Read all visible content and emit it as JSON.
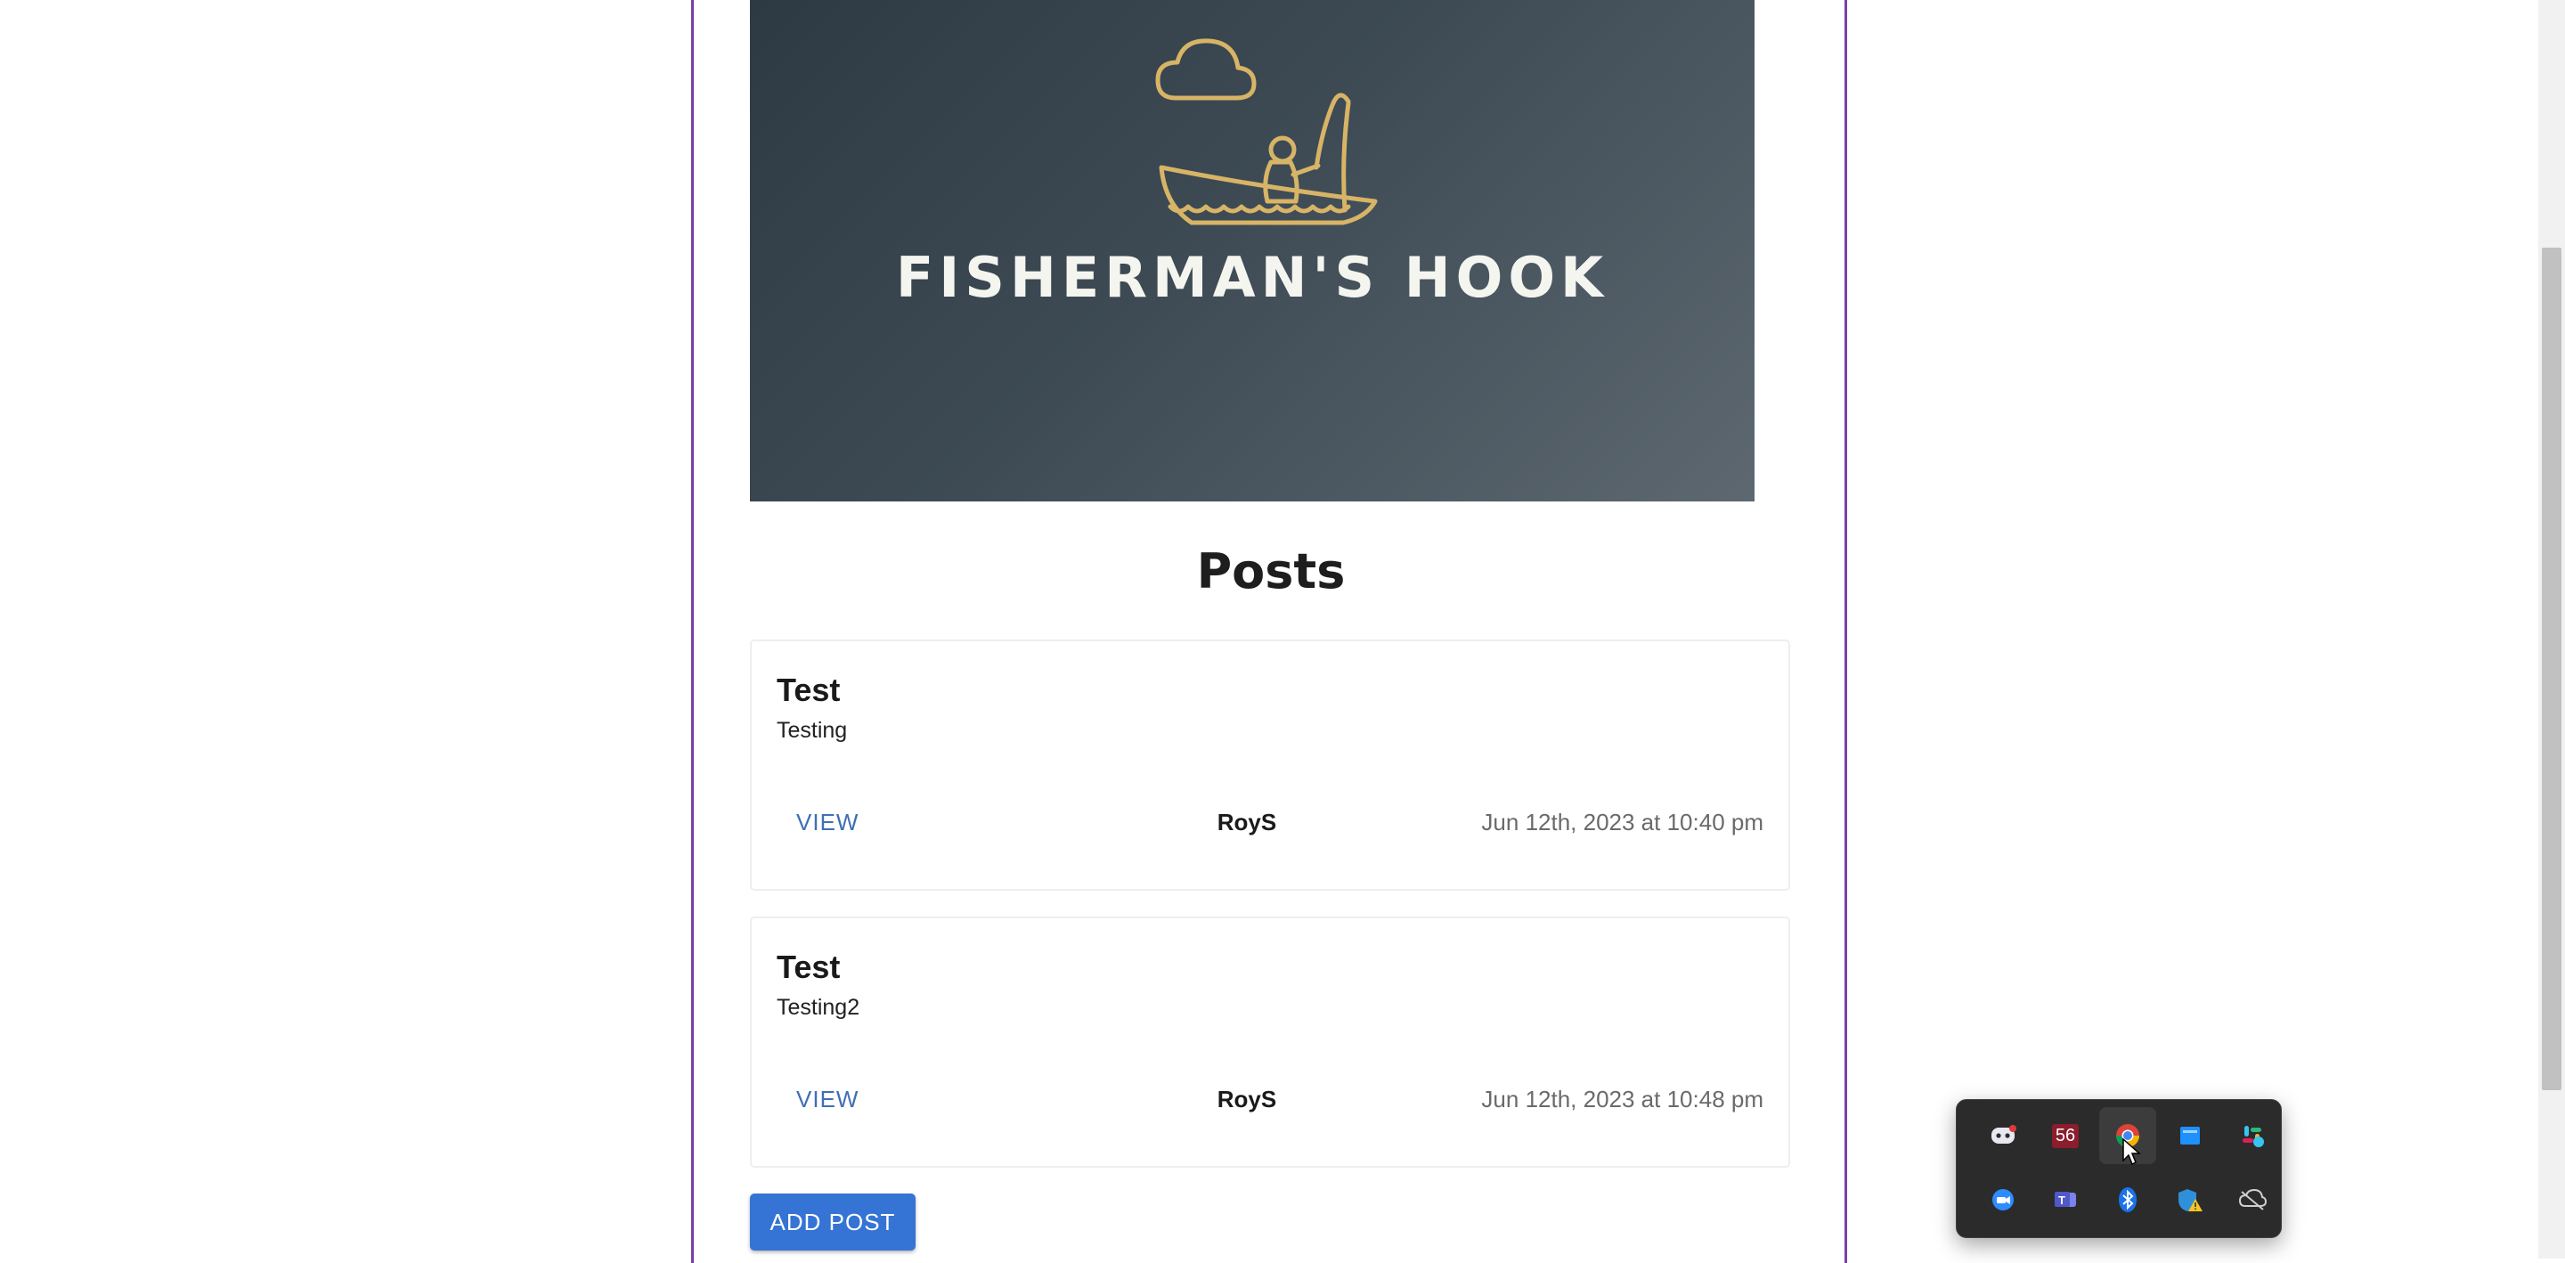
{
  "banner": {
    "logo_text": "FISHERMAN'S HOOK"
  },
  "posts": {
    "title": "Posts",
    "items": [
      {
        "title": "Test",
        "body": "Testing",
        "view_label": "VIEW",
        "author": "RoyS",
        "date": "Jun 12th, 2023 at 10:40 pm"
      },
      {
        "title": "Test",
        "body": "Testing2",
        "view_label": "VIEW",
        "author": "RoyS",
        "date": "Jun 12th, 2023 at 10:48 pm"
      }
    ],
    "add_label": "ADD POST"
  },
  "tray": {
    "row1": [
      "discord-icon",
      "badge-56-icon",
      "chrome-icon",
      "window-app-icon",
      "slack-icon"
    ],
    "row2": [
      "zoom-icon",
      "teams-icon",
      "bluetooth-icon",
      "security-warning-icon",
      "cloud-offline-icon"
    ],
    "badge_text": "56"
  },
  "colors": {
    "accent": "#3574d4",
    "frame": "#7b3fa8",
    "link": "#3f6fb5"
  }
}
